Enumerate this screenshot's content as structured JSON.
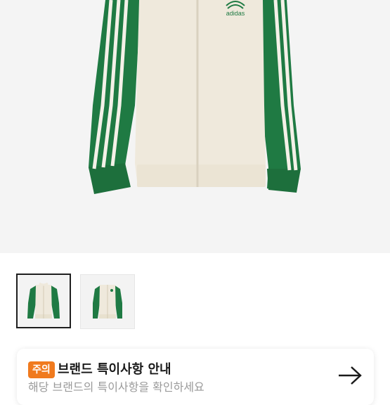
{
  "product": {
    "logo_text": "adidas",
    "colors": {
      "body": "#efe9dc",
      "sleeve": "#1f7a43",
      "stripe": "#f4f1e8"
    }
  },
  "thumbnails": [
    {
      "label": "thumbnail-1",
      "selected": true
    },
    {
      "label": "thumbnail-2",
      "selected": false
    }
  ],
  "notice": {
    "badge": "주의",
    "title": "브랜드 특이사항 안내",
    "subtitle": "해당 브랜드의 특이사항을 확인하세요",
    "arrow_icon": "arrow-right-icon",
    "badge_color": "#f07a1e"
  }
}
